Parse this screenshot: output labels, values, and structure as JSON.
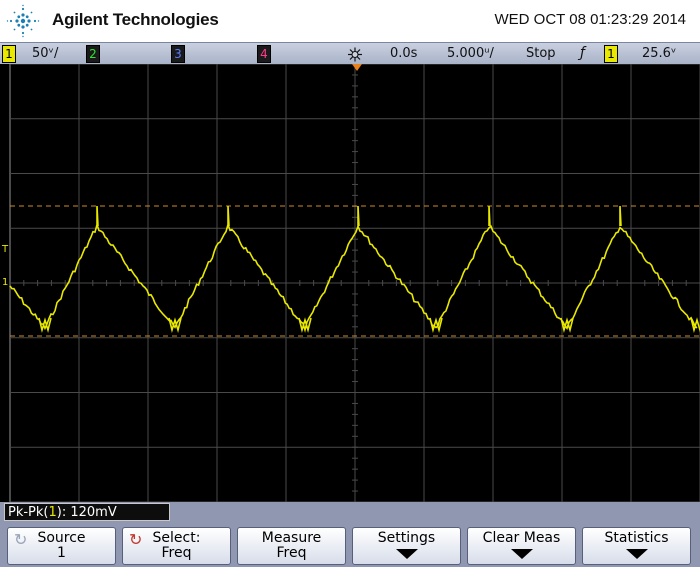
{
  "header": {
    "brand": "Agilent Technologies",
    "datetime": "WED OCT 08 01:23:29 2014"
  },
  "status": {
    "ch1_num": "1",
    "ch1_scale": "50ᵛ/",
    "ch2_num": "2",
    "ch3_num": "3",
    "ch4_num": "4",
    "delay": "0.0s",
    "timebase": "5.000ᵘ/",
    "run_state": "Stop",
    "trigger_slope": "ƒ",
    "trigger_src": "1",
    "trigger_level": "25.6ᵛ"
  },
  "measurement": {
    "label_prefix": "Pk-Pk(",
    "source": "1",
    "label_suffix": "): 120mV"
  },
  "markers": {
    "trigger": "T",
    "ground": "1"
  },
  "softkeys": {
    "source_title": "Source",
    "source_value": "1",
    "select_title": "Select:",
    "select_value": "Freq",
    "measure_title": "Measure",
    "measure_value": "Freq",
    "settings_title": "Settings",
    "clear_title": "Clear Meas",
    "stats_title": "Statistics"
  },
  "colors": {
    "trace": "#e8e800",
    "cursor": "#d08a2a",
    "grid": "#4a4a4a"
  }
}
